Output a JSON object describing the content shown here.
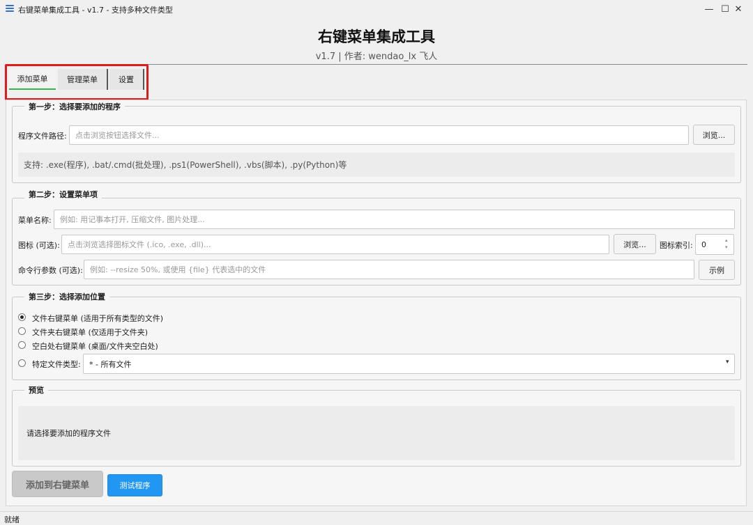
{
  "window": {
    "title": "右键菜单集成工具 - v1.7 - 支持多种文件类型",
    "minimize": "—",
    "maximize": "☐",
    "close": "✕"
  },
  "header": {
    "title": "右键菜单集成工具",
    "subtitle": "v1.7 | 作者: wendao_lx 飞人"
  },
  "tabs": [
    {
      "label": "添加菜单"
    },
    {
      "label": "管理菜单"
    },
    {
      "label": "设置"
    }
  ],
  "step1": {
    "title": "第一步：选择要添加的程序",
    "path_label": "程序文件路径:",
    "path_placeholder": "点击浏览按钮选择文件...",
    "browse": "浏览...",
    "hint": "支持: .exe(程序), .bat/.cmd(批处理), .ps1(PowerShell), .vbs(脚本), .py(Python)等"
  },
  "step2": {
    "title": "第二步：设置菜单项",
    "name_label": "菜单名称:",
    "name_placeholder": "例如: 用记事本打开, 压缩文件, 图片处理...",
    "icon_label": "图标 (可选):",
    "icon_placeholder": "点击浏览选择图标文件 (.ico, .exe, .dll)...",
    "icon_browse": "浏览...",
    "icon_index_label": "图标索引:",
    "icon_index_value": "0",
    "args_label": "命令行参数 (可选):",
    "args_placeholder": "例如: --resize 50%, 或使用 {file} 代表选中的文件",
    "example": "示例"
  },
  "step3": {
    "title": "第三步：选择添加位置",
    "options": [
      {
        "label": "文件右键菜单 (适用于所有类型的文件)"
      },
      {
        "label": "文件夹右键菜单 (仅适用于文件夹)"
      },
      {
        "label": "空白处右键菜单 (桌面/文件夹空白处)"
      }
    ],
    "filetype_label": "特定文件类型:",
    "filetype_value": "* - 所有文件"
  },
  "preview": {
    "title": "预览",
    "text": "请选择要添加的程序文件"
  },
  "actions": {
    "add": "添加到右键菜单",
    "test": "测试程序"
  },
  "status": {
    "text": "就绪"
  },
  "colors": {
    "accent": "#2196f3",
    "tab_indicator": "#3bb34a",
    "highlight": "#e11b1b"
  }
}
